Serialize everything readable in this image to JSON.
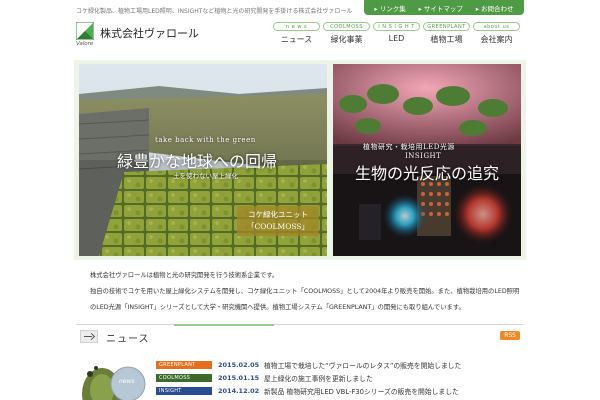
{
  "header": {
    "tagline": "コケ緑化製品、植物工場用LED照明、INSIGHTなど植物と光の研究開発を手掛ける株式会社ヴァロール",
    "util_links": [
      {
        "label": "▸ リンク集"
      },
      {
        "label": "▸ サイトマップ"
      },
      {
        "label": "▸ お問合わせ"
      }
    ],
    "logo": {
      "name": "株式会社ヴァロール",
      "sub": "Valore"
    },
    "nav": [
      {
        "en": "n e w s",
        "ja": "ニュース"
      },
      {
        "en": "COOLMOSS",
        "ja": "緑化事業"
      },
      {
        "en": "I N S I G H T",
        "ja": "LED"
      },
      {
        "en": "GREENPLANT",
        "ja": "植物工場"
      },
      {
        "en": "about us",
        "ja": "会社案内"
      }
    ]
  },
  "hero": {
    "left": {
      "subtitle": "take back with the green",
      "title": "緑豊かな地球への回帰",
      "note": "土を使わない屋上緑化",
      "badge_line1": "コケ緑化ユニット",
      "badge_line2": "「COOLMOSS」"
    },
    "right": {
      "subtitle": "植物研究・栽培用LED光源",
      "subtitle2": "INSIGHT",
      "title": "生物の光反応の追究"
    }
  },
  "intro": [
    "株式会社ヴァロールは植物と光の研究開発を行う技術系企業です。",
    "独自の技術でコケを用いた屋上緑化システムを開発し、コケ緑化ユニット「COOLMOSS」として2004年より販売を開始。また、植物栽培用のLED照明を開発し、植物研究用",
    "のLED光源「INSIGHT」シリーズとして大学・研究機関へ提供。植物工場システム「GREENPLANT」の開発にも取り組んでいます。"
  ],
  "news": {
    "title": "ニュース",
    "rss": "RSS",
    "illust_label": "news",
    "items": [
      {
        "category": "GREENPLANT",
        "date": "2015.02.05",
        "title": "植物工場で栽培した“ヴァロールのレタス”の販売を開始しました"
      },
      {
        "category": "COOLMOSS",
        "date": "2015.01.15",
        "title": "屋上緑化の施工事例を更新しました"
      },
      {
        "category": "INSIGHT",
        "date": "2014.12.02",
        "title": "新製品 植物研究用LED VBL-F30シリーズの販売を開始しました"
      }
    ]
  },
  "colors": {
    "brand_green": "#4f9a44",
    "nav_accent": "#9bc98f",
    "cat_greenplant": "#e3701f",
    "cat_coolmoss": "#3e6b2c",
    "cat_insight": "#2a4c93",
    "rss": "#f08a24",
    "date_blue": "#2b4c8c"
  }
}
